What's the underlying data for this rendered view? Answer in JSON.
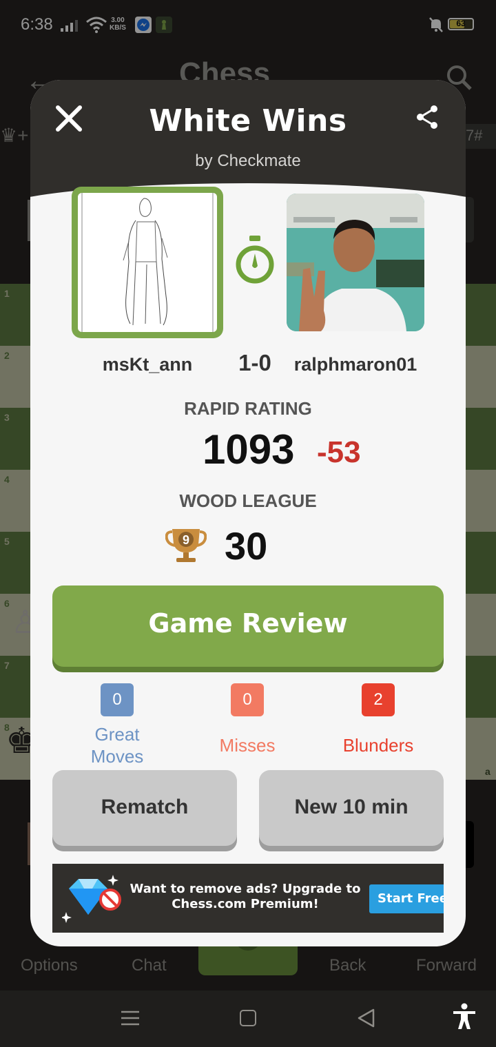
{
  "status_bar": {
    "time": "6:38",
    "speed_value": "3.00",
    "speed_unit": "KB/S",
    "battery": "63"
  },
  "background": {
    "app_title": "Chess",
    "ranks": [
      "1",
      "2",
      "3",
      "4",
      "5",
      "6",
      "7",
      "8"
    ],
    "file_label": "a",
    "move_badge": "7#",
    "nav": {
      "options": "Options",
      "chat": "Chat",
      "back": "Back",
      "forward": "Forward"
    }
  },
  "modal": {
    "title": "White Wins",
    "subtitle": "by Checkmate",
    "player_white": "msKt_ann",
    "score": "1-0",
    "player_black": "ralphmaron01",
    "rating_label": "RAPID RATING",
    "rating_value": "1093",
    "rating_change": "-53",
    "league_label": "WOOD LEAGUE",
    "league_value": "30",
    "trophy_rank": "9",
    "review_button": "Game Review",
    "stats": [
      {
        "value": "0",
        "label_line1": "Great",
        "label_line2": "Moves",
        "color": "#6d93c4",
        "text_color": "#6d93c4"
      },
      {
        "value": "0",
        "label_line1": "Misses",
        "label_line2": "",
        "color": "#f27a62",
        "text_color": "#f27a62"
      },
      {
        "value": "2",
        "label_line1": "Blunders",
        "label_line2": "",
        "color": "#e8412e",
        "text_color": "#e8412e"
      }
    ],
    "rematch_button": "Rematch",
    "new_game_button": "New 10 min",
    "ad": {
      "text": "Want to remove ads? Upgrade to Chess.com Premium!",
      "button": "Start Free"
    }
  },
  "colors": {
    "accent_green": "#81a94a",
    "loss_red": "#c8342c",
    "board_light": "#c3c5a8",
    "board_dark": "#5e7b42"
  }
}
